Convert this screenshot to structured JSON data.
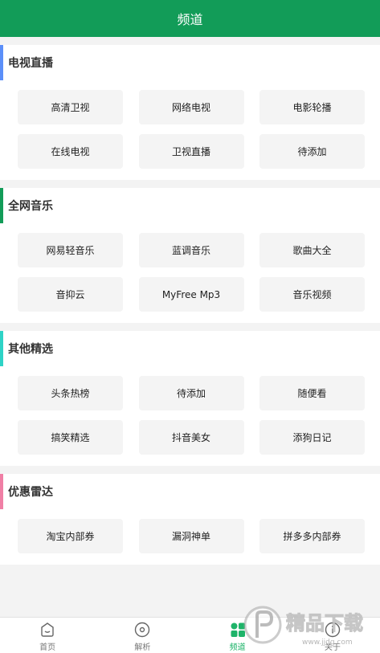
{
  "header": {
    "title": "频道"
  },
  "sections": [
    {
      "title": "电视直播",
      "accent": "#5b8ff9",
      "rows": [
        [
          "高清卫视",
          "网络电视",
          "电影轮播"
        ],
        [
          "在线电视",
          "卫视直播",
          "待添加"
        ]
      ]
    },
    {
      "title": "全网音乐",
      "accent": "#129c58",
      "rows": [
        [
          "网易轻音乐",
          "蓝调音乐",
          "歌曲大全"
        ],
        [
          "音抑云",
          "MyFree Mp3",
          "音乐视频"
        ]
      ]
    },
    {
      "title": "其他精选",
      "accent": "#2ed3c6",
      "rows": [
        [
          "头条热榜",
          "待添加",
          "随便看"
        ],
        [
          "搞笑精选",
          "抖音美女",
          "添狗日记"
        ]
      ]
    },
    {
      "title": "优惠雷达",
      "accent": "#f07fa5",
      "rows": [
        [
          "淘宝内部券",
          "漏洞神单",
          "拼多多内部券"
        ]
      ]
    }
  ],
  "nav": {
    "items": [
      {
        "label": "首页",
        "icon": "home-icon"
      },
      {
        "label": "解析",
        "icon": "disc-icon"
      },
      {
        "label": "频道",
        "icon": "grid-icon",
        "active": true
      },
      {
        "label": "关于",
        "icon": "info-icon"
      }
    ]
  },
  "watermark": {
    "text": "精品下载",
    "url": "www.jjdg.com"
  },
  "colors": {
    "brand": "#129c58",
    "active": "#1fb46a"
  }
}
